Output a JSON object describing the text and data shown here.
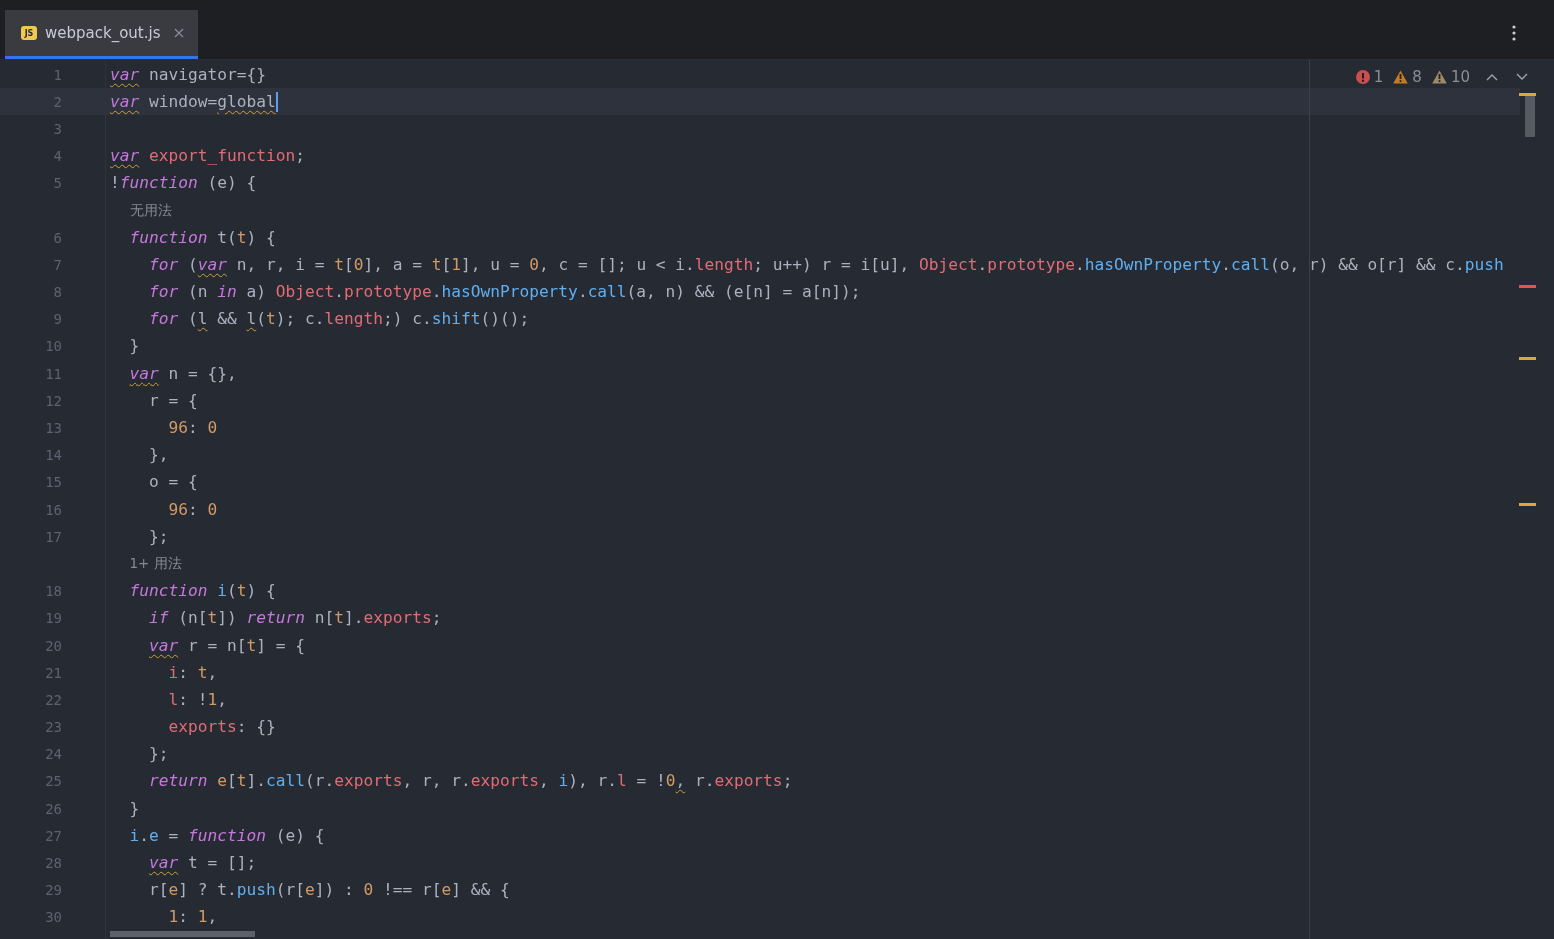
{
  "tabs": [
    {
      "icon_text": "JS",
      "label": "webpack_out.js",
      "selected": true
    }
  ],
  "inspections": [
    {
      "kind": "error",
      "count": "1"
    },
    {
      "kind": "warning",
      "count": "8"
    },
    {
      "kind": "weak_warning",
      "count": "10"
    }
  ],
  "scroll_markers": [
    {
      "color": "#e8a23c"
    },
    {
      "color": "#e5534b"
    },
    {
      "color": "#e8a23c"
    },
    {
      "color": "#e8a23c"
    }
  ],
  "lines": [
    {
      "kind": "code",
      "number": "1",
      "current": false,
      "tokens": [
        {
          "kind": "kw",
          "t": "var",
          "warning": true
        },
        {
          "kind": "p",
          "t": " navigator={}"
        }
      ]
    },
    {
      "kind": "code",
      "number": "2",
      "current": true,
      "tokens": [
        {
          "kind": "kw",
          "t": "var",
          "warning": true
        },
        {
          "kind": "p",
          "t": " window="
        },
        {
          "kind": "p",
          "t": "global",
          "warning": true
        }
      ]
    },
    {
      "kind": "code",
      "number": "3",
      "current": false
    },
    {
      "kind": "code",
      "number": "4",
      "current": false,
      "tokens": [
        {
          "kind": "kw",
          "t": "var",
          "warning": true
        },
        {
          "kind": "prop",
          "t": " export_function"
        },
        {
          "kind": "p",
          "t": ";"
        }
      ]
    },
    {
      "kind": "code",
      "number": "5",
      "current": false,
      "tokens": [
        {
          "kind": "p",
          "t": "!"
        },
        {
          "kind": "kw",
          "t": "function"
        },
        {
          "kind": "p",
          "t": " (e) {"
        }
      ],
      "children": [
        {
          "kind": "hint",
          "text": "无用法"
        },
        {
          "kind": "code",
          "number": "6",
          "current": false,
          "tokens": [
            {
              "kind": "kw",
              "t": "function"
            },
            {
              "kind": "p",
              "t": " t("
            },
            {
              "kind": "param",
              "t": "t"
            },
            {
              "kind": "p",
              "t": ") {"
            }
          ],
          "children": [
            {
              "kind": "code",
              "number": "7",
              "current": false,
              "tokens": [
                {
                  "kind": "kw",
                  "t": "for"
                },
                {
                  "kind": "p",
                  "t": " ("
                },
                {
                  "kind": "kw",
                  "t": "var",
                  "warning": true
                },
                {
                  "kind": "p",
                  "t": " n, r, i = "
                },
                {
                  "kind": "param",
                  "t": "t"
                },
                {
                  "kind": "p",
                  "t": "["
                },
                {
                  "kind": "num",
                  "t": "0"
                },
                {
                  "kind": "p",
                  "t": "], a = "
                },
                {
                  "kind": "param",
                  "t": "t"
                },
                {
                  "kind": "p",
                  "t": "["
                },
                {
                  "kind": "num",
                  "t": "1"
                },
                {
                  "kind": "p",
                  "t": "], u = "
                },
                {
                  "kind": "num",
                  "t": "0"
                },
                {
                  "kind": "p",
                  "t": ", c = []; u < i."
                },
                {
                  "kind": "prop",
                  "t": "length"
                },
                {
                  "kind": "p",
                  "t": "; u++) r = i[u], "
                },
                {
                  "kind": "prop",
                  "t": "Object"
                },
                {
                  "kind": "p",
                  "t": "."
                },
                {
                  "kind": "prop",
                  "t": "prototype"
                },
                {
                  "kind": "p",
                  "t": "."
                },
                {
                  "kind": "fn",
                  "t": "hasOwnProperty"
                },
                {
                  "kind": "p",
                  "t": "."
                },
                {
                  "kind": "fn",
                  "t": "call"
                },
                {
                  "kind": "p",
                  "t": "(o, r) && o[r] && c."
                },
                {
                  "kind": "fn",
                  "t": "push"
                }
              ]
            },
            {
              "kind": "code",
              "number": "8",
              "current": false,
              "tokens": [
                {
                  "kind": "kw",
                  "t": "for"
                },
                {
                  "kind": "p",
                  "t": " (n "
                },
                {
                  "kind": "kw",
                  "t": "in"
                },
                {
                  "kind": "p",
                  "t": " a) "
                },
                {
                  "kind": "prop",
                  "t": "Object"
                },
                {
                  "kind": "p",
                  "t": "."
                },
                {
                  "kind": "prop",
                  "t": "prototype"
                },
                {
                  "kind": "p",
                  "t": "."
                },
                {
                  "kind": "fn",
                  "t": "hasOwnProperty"
                },
                {
                  "kind": "p",
                  "t": "."
                },
                {
                  "kind": "fn",
                  "t": "call"
                },
                {
                  "kind": "p",
                  "t": "(a, n) && (e[n] = a[n]);"
                }
              ]
            },
            {
              "kind": "code",
              "number": "9",
              "current": false,
              "tokens": [
                {
                  "kind": "kw",
                  "t": "for"
                },
                {
                  "kind": "p",
                  "t": " ("
                },
                {
                  "kind": "p",
                  "t": "l",
                  "warning": true
                },
                {
                  "kind": "p",
                  "t": " && "
                },
                {
                  "kind": "p",
                  "t": "l",
                  "warning": true
                },
                {
                  "kind": "p",
                  "t": "("
                },
                {
                  "kind": "param",
                  "t": "t"
                },
                {
                  "kind": "p",
                  "t": "); c."
                },
                {
                  "kind": "prop",
                  "t": "length"
                },
                {
                  "kind": "p",
                  "t": ";) c."
                },
                {
                  "kind": "fn",
                  "t": "shift"
                },
                {
                  "kind": "p",
                  "t": "()();"
                }
              ]
            }
          ]
        },
        {
          "kind": "code",
          "number": "10",
          "current": false,
          "tokens": [
            {
              "kind": "p",
              "t": "}"
            }
          ]
        },
        {
          "kind": "code",
          "number": "11",
          "current": false,
          "tokens": [
            {
              "kind": "kw",
              "t": "var",
              "warning": true
            },
            {
              "kind": "p",
              "t": " n = {},"
            }
          ],
          "children": [
            {
              "kind": "code",
              "number": "12",
              "current": false,
              "tokens": [
                {
                  "kind": "p",
                  "t": "r = {"
                }
              ],
              "children": [
                {
                  "kind": "code",
                  "number": "13",
                  "current": false,
                  "tokens": [
                    {
                      "kind": "num",
                      "t": "96"
                    },
                    {
                      "kind": "p",
                      "t": ": "
                    },
                    {
                      "kind": "num",
                      "t": "0"
                    }
                  ]
                }
              ]
            },
            {
              "kind": "code",
              "number": "14",
              "current": false,
              "tokens": [
                {
                  "kind": "p",
                  "t": "},"
                }
              ]
            },
            {
              "kind": "code",
              "number": "15",
              "current": false,
              "tokens": [
                {
                  "kind": "p",
                  "t": "o = {"
                }
              ],
              "children": [
                {
                  "kind": "code",
                  "number": "16",
                  "current": false,
                  "tokens": [
                    {
                      "kind": "num",
                      "t": "96"
                    },
                    {
                      "kind": "p",
                      "t": ": "
                    },
                    {
                      "kind": "num",
                      "t": "0"
                    }
                  ]
                }
              ]
            },
            {
              "kind": "code",
              "number": "17",
              "current": false,
              "tokens": [
                {
                  "kind": "p",
                  "t": "};"
                }
              ]
            }
          ]
        },
        {
          "kind": "hint",
          "text": "1+ 用法"
        },
        {
          "kind": "code",
          "number": "18",
          "current": false,
          "tokens": [
            {
              "kind": "kw",
              "t": "function"
            },
            {
              "kind": "fn",
              "t": " i"
            },
            {
              "kind": "p",
              "t": "("
            },
            {
              "kind": "param",
              "t": "t"
            },
            {
              "kind": "p",
              "t": ") {"
            }
          ],
          "children": [
            {
              "kind": "code",
              "number": "19",
              "current": false,
              "tokens": [
                {
                  "kind": "kw",
                  "t": "if"
                },
                {
                  "kind": "p",
                  "t": " (n["
                },
                {
                  "kind": "param",
                  "t": "t"
                },
                {
                  "kind": "p",
                  "t": "]) "
                },
                {
                  "kind": "kw",
                  "t": "return"
                },
                {
                  "kind": "p",
                  "t": " n["
                },
                {
                  "kind": "param",
                  "t": "t"
                },
                {
                  "kind": "p",
                  "t": "]."
                },
                {
                  "kind": "prop",
                  "t": "exports"
                },
                {
                  "kind": "p",
                  "t": ";"
                }
              ]
            },
            {
              "kind": "code",
              "number": "20",
              "current": false,
              "tokens": [
                {
                  "kind": "kw",
                  "t": "var",
                  "warning": true
                },
                {
                  "kind": "p",
                  "t": " r = n["
                },
                {
                  "kind": "param",
                  "t": "t"
                },
                {
                  "kind": "p",
                  "t": "] = {"
                }
              ],
              "children": [
                {
                  "kind": "code",
                  "number": "21",
                  "current": false,
                  "tokens": [
                    {
                      "kind": "prop",
                      "t": "i"
                    },
                    {
                      "kind": "p",
                      "t": ": "
                    },
                    {
                      "kind": "param",
                      "t": "t"
                    },
                    {
                      "kind": "p",
                      "t": ","
                    }
                  ]
                },
                {
                  "kind": "code",
                  "number": "22",
                  "current": false,
                  "tokens": [
                    {
                      "kind": "prop",
                      "t": "l"
                    },
                    {
                      "kind": "p",
                      "t": ": !"
                    },
                    {
                      "kind": "num",
                      "t": "1"
                    },
                    {
                      "kind": "p",
                      "t": ","
                    }
                  ]
                },
                {
                  "kind": "code",
                  "number": "23",
                  "current": false,
                  "tokens": [
                    {
                      "kind": "prop",
                      "t": "exports"
                    },
                    {
                      "kind": "p",
                      "t": ": {}"
                    }
                  ]
                }
              ]
            },
            {
              "kind": "code",
              "number": "24",
              "current": false,
              "tokens": [
                {
                  "kind": "p",
                  "t": "};"
                }
              ]
            },
            {
              "kind": "code",
              "number": "25",
              "current": false,
              "tokens": [
                {
                  "kind": "kw",
                  "t": "return"
                },
                {
                  "kind": "param",
                  "t": " e"
                },
                {
                  "kind": "p",
                  "t": "["
                },
                {
                  "kind": "param",
                  "t": "t"
                },
                {
                  "kind": "p",
                  "t": "]."
                },
                {
                  "kind": "fn",
                  "t": "call"
                },
                {
                  "kind": "p",
                  "t": "(r."
                },
                {
                  "kind": "prop",
                  "t": "exports"
                },
                {
                  "kind": "p",
                  "t": ", r, r."
                },
                {
                  "kind": "prop",
                  "t": "exports"
                },
                {
                  "kind": "p",
                  "t": ", "
                },
                {
                  "kind": "fn",
                  "t": "i"
                },
                {
                  "kind": "p",
                  "t": "), r."
                },
                {
                  "kind": "prop",
                  "t": "l"
                },
                {
                  "kind": "p",
                  "t": " = !"
                },
                {
                  "kind": "num",
                  "t": "0"
                },
                {
                  "kind": "p",
                  "t": ",",
                  "warning": true
                },
                {
                  "kind": "p",
                  "t": " r."
                },
                {
                  "kind": "prop",
                  "t": "exports"
                },
                {
                  "kind": "p",
                  "t": ";"
                }
              ]
            }
          ]
        },
        {
          "kind": "code",
          "number": "26",
          "current": false,
          "tokens": [
            {
              "kind": "p",
              "t": "}"
            }
          ]
        },
        {
          "kind": "code",
          "number": "27",
          "current": false,
          "tokens": [
            {
              "kind": "fn",
              "t": "i"
            },
            {
              "kind": "p",
              "t": "."
            },
            {
              "kind": "fn",
              "t": "e"
            },
            {
              "kind": "p",
              "t": " = "
            },
            {
              "kind": "kw",
              "t": "function"
            },
            {
              "kind": "p",
              "t": " (e) {"
            }
          ],
          "children": [
            {
              "kind": "code",
              "number": "28",
              "current": false,
              "tokens": [
                {
                  "kind": "kw",
                  "t": "var",
                  "warning": true
                },
                {
                  "kind": "p",
                  "t": " t = [];"
                }
              ]
            },
            {
              "kind": "code",
              "number": "29",
              "current": false,
              "tokens": [
                {
                  "kind": "p",
                  "t": "r["
                },
                {
                  "kind": "param",
                  "t": "e"
                },
                {
                  "kind": "p",
                  "t": "] ? t."
                },
                {
                  "kind": "fn",
                  "t": "push"
                },
                {
                  "kind": "p",
                  "t": "(r["
                },
                {
                  "kind": "param",
                  "t": "e"
                },
                {
                  "kind": "p",
                  "t": "]) : "
                },
                {
                  "kind": "num",
                  "t": "0"
                },
                {
                  "kind": "p",
                  "t": " !== r["
                },
                {
                  "kind": "param",
                  "t": "e"
                },
                {
                  "kind": "p",
                  "t": "] && {"
                }
              ],
              "children": [
                {
                  "kind": "code",
                  "number": "30",
                  "current": false,
                  "tokens": [
                    {
                      "kind": "num",
                      "t": "1"
                    },
                    {
                      "kind": "p",
                      "t": ": "
                    },
                    {
                      "kind": "num",
                      "t": "1"
                    },
                    {
                      "kind": "p",
                      "t": ","
                    }
                  ]
                }
              ]
            }
          ]
        }
      ]
    }
  ]
}
